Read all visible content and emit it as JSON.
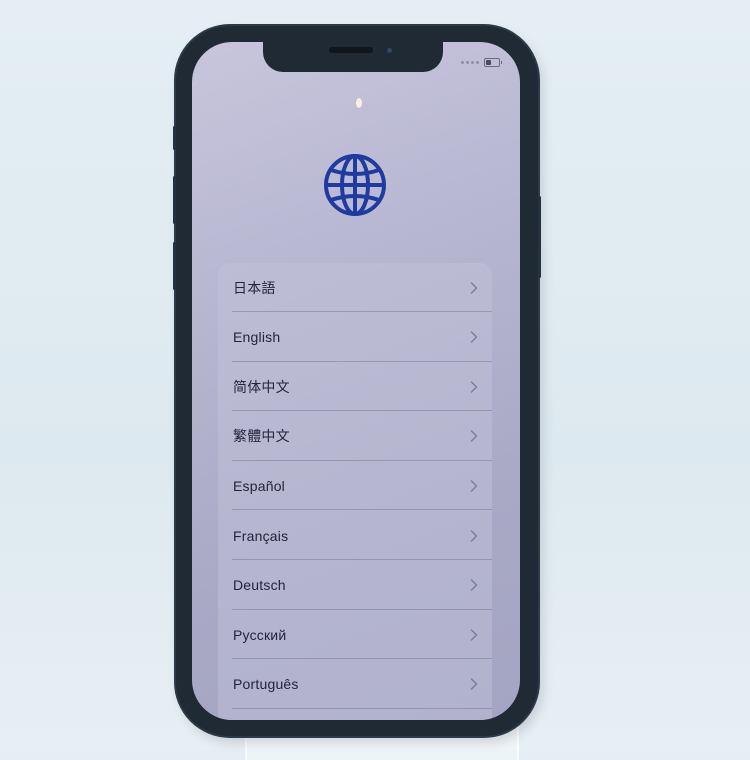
{
  "device": {
    "status_bar": {
      "signal_icon": "signal-dots-icon",
      "battery_icon": "battery-icon",
      "battery_level_fraction": 0.35
    }
  },
  "screen": {
    "hero_icon": "globe-icon",
    "accent_color": "#1f3aa0",
    "languages": [
      {
        "label": "日本語",
        "icon": "chevron-right-icon"
      },
      {
        "label": "English",
        "icon": "chevron-right-icon"
      },
      {
        "label": "简体中文",
        "icon": "chevron-right-icon"
      },
      {
        "label": "繁體中文",
        "icon": "chevron-right-icon"
      },
      {
        "label": "Español",
        "icon": "chevron-right-icon"
      },
      {
        "label": "Français",
        "icon": "chevron-right-icon"
      },
      {
        "label": "Deutsch",
        "icon": "chevron-right-icon"
      },
      {
        "label": "Русский",
        "icon": "chevron-right-icon"
      },
      {
        "label": "Português",
        "icon": "chevron-right-icon"
      }
    ]
  }
}
